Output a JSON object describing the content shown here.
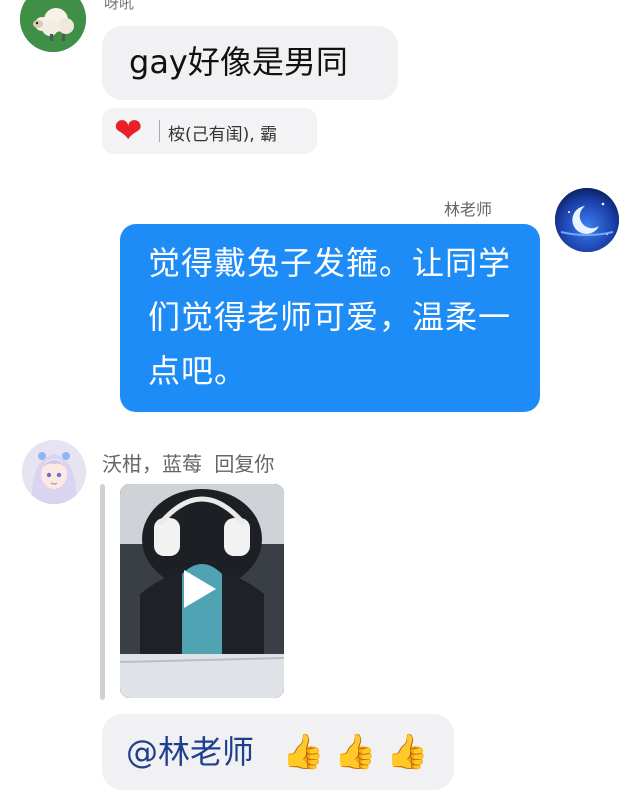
{
  "messages": [
    {
      "sender": "呀吼",
      "text": "gay好像是男同",
      "reaction": {
        "emoji": "❤",
        "users": "桉(己有闺), 霸"
      }
    },
    {
      "sender": "林老师",
      "text": "觉得戴兔子发箍。让同学们觉得老师可爱，温柔一点吧。"
    },
    {
      "sender": "沃柑，蓝莓",
      "reply_label": "回复你",
      "reply_media": "video",
      "text": "@林老师",
      "emojis": [
        "👍",
        "👍",
        "👍"
      ]
    }
  ],
  "colors": {
    "own_bubble": "#1e8cf6",
    "other_bubble": "#f1f1f3",
    "heart": "#e8202a"
  }
}
